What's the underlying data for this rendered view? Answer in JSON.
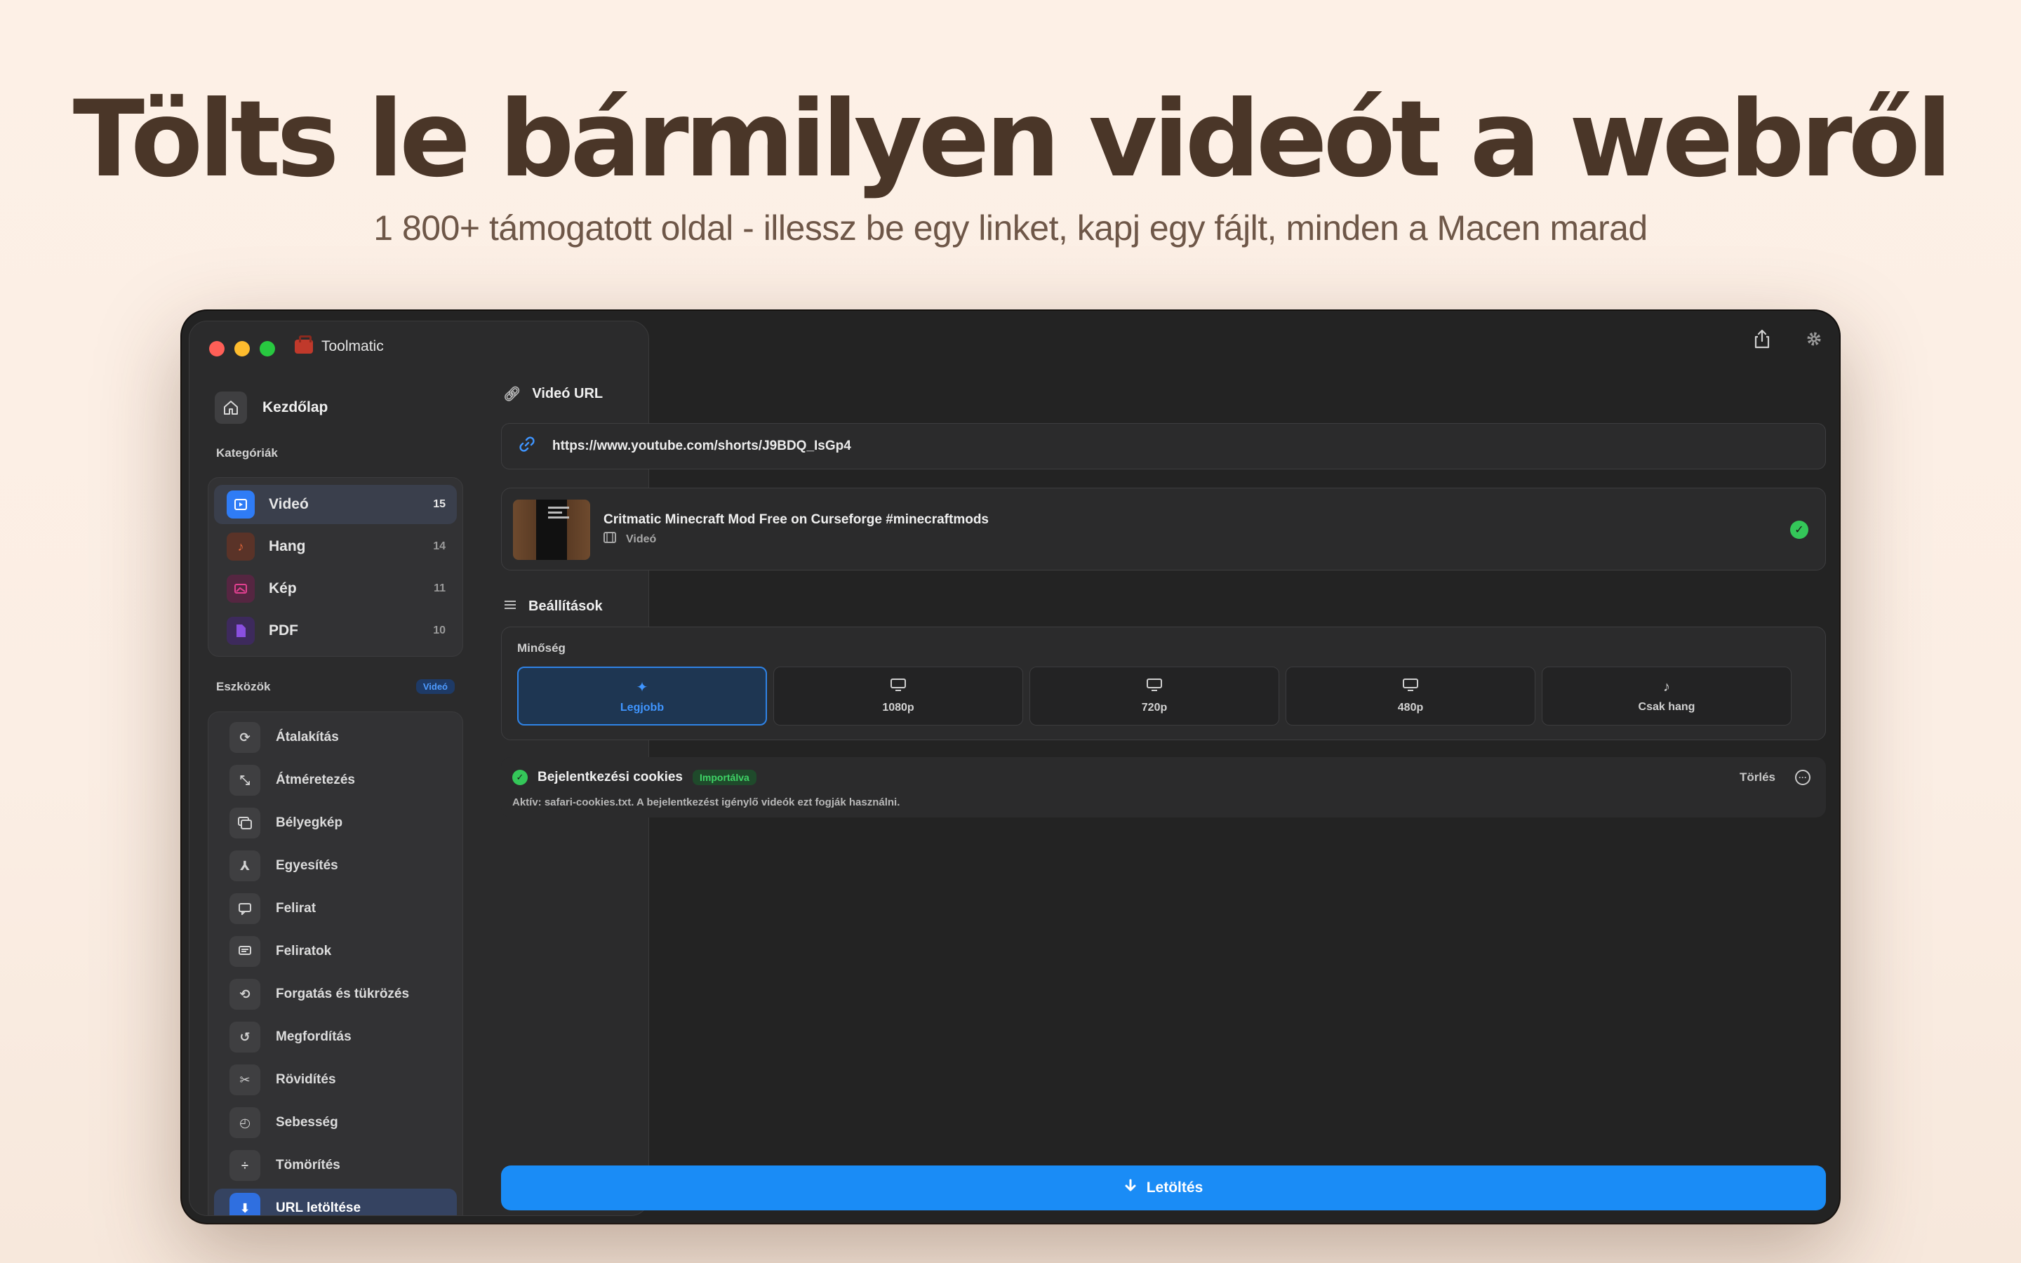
{
  "hero": {
    "title": "Tölts le bármilyen videót a webről",
    "subtitle": "1 800+ támogatott oldal - illessz be egy linket, kapj egy fájlt, minden a Macen marad"
  },
  "app": {
    "title": "Toolmatic"
  },
  "sidebar": {
    "home_label": "Kezdőlap",
    "categories_label": "Kategóriák",
    "categories": [
      {
        "label": "Videó",
        "count": "15",
        "icon": "play-icon",
        "color": "#2f7cf6"
      },
      {
        "label": "Hang",
        "count": "14",
        "icon": "music-note-icon",
        "color": "#e8683a"
      },
      {
        "label": "Kép",
        "count": "11",
        "icon": "image-icon",
        "color": "#e0408f"
      },
      {
        "label": "PDF",
        "count": "10",
        "icon": "document-icon",
        "color": "#8a4fe0"
      }
    ],
    "tools_label": "Eszközök",
    "tools_badge": "Videó",
    "tools": [
      {
        "label": "Átalakítás",
        "icon": "convert-icon"
      },
      {
        "label": "Átméretezés",
        "icon": "resize-icon"
      },
      {
        "label": "Bélyegkép",
        "icon": "thumbnail-icon"
      },
      {
        "label": "Egyesítés",
        "icon": "merge-icon"
      },
      {
        "label": "Felirat",
        "icon": "caption-icon"
      },
      {
        "label": "Feliratok",
        "icon": "subtitles-icon"
      },
      {
        "label": "Forgatás és tükrözés",
        "icon": "rotate-icon"
      },
      {
        "label": "Megfordítás",
        "icon": "reverse-icon"
      },
      {
        "label": "Rövidítés",
        "icon": "scissors-icon"
      },
      {
        "label": "Sebesség",
        "icon": "speed-icon"
      },
      {
        "label": "Tömörítés",
        "icon": "compress-icon"
      },
      {
        "label": "URL letöltése",
        "icon": "download-icon"
      }
    ]
  },
  "main": {
    "url_label": "Videó URL",
    "url_value": "https://www.youtube.com/shorts/J9BDQ_IsGp4",
    "video": {
      "title": "Critmatic Minecraft Mod Free on Curseforge #minecraftmods",
      "type": "Videó"
    },
    "settings_label": "Beállítások",
    "quality": {
      "label": "Minőség",
      "options": [
        {
          "label": "Legjobb",
          "icon": "sparkle-icon"
        },
        {
          "label": "1080p",
          "icon": "monitor-icon"
        },
        {
          "label": "720p",
          "icon": "monitor-icon"
        },
        {
          "label": "480p",
          "icon": "monitor-icon"
        },
        {
          "label": "Csak hang",
          "icon": "music-note-icon"
        }
      ],
      "selected": "Legjobb"
    },
    "cookies": {
      "title": "Bejelentkezési cookies",
      "badge": "Importálva",
      "description": "Aktív: safari-cookies.txt. A bejelentkezést igénylő videók ezt fogják használni.",
      "clear_label": "Törlés"
    },
    "download_label": "Letöltés"
  }
}
